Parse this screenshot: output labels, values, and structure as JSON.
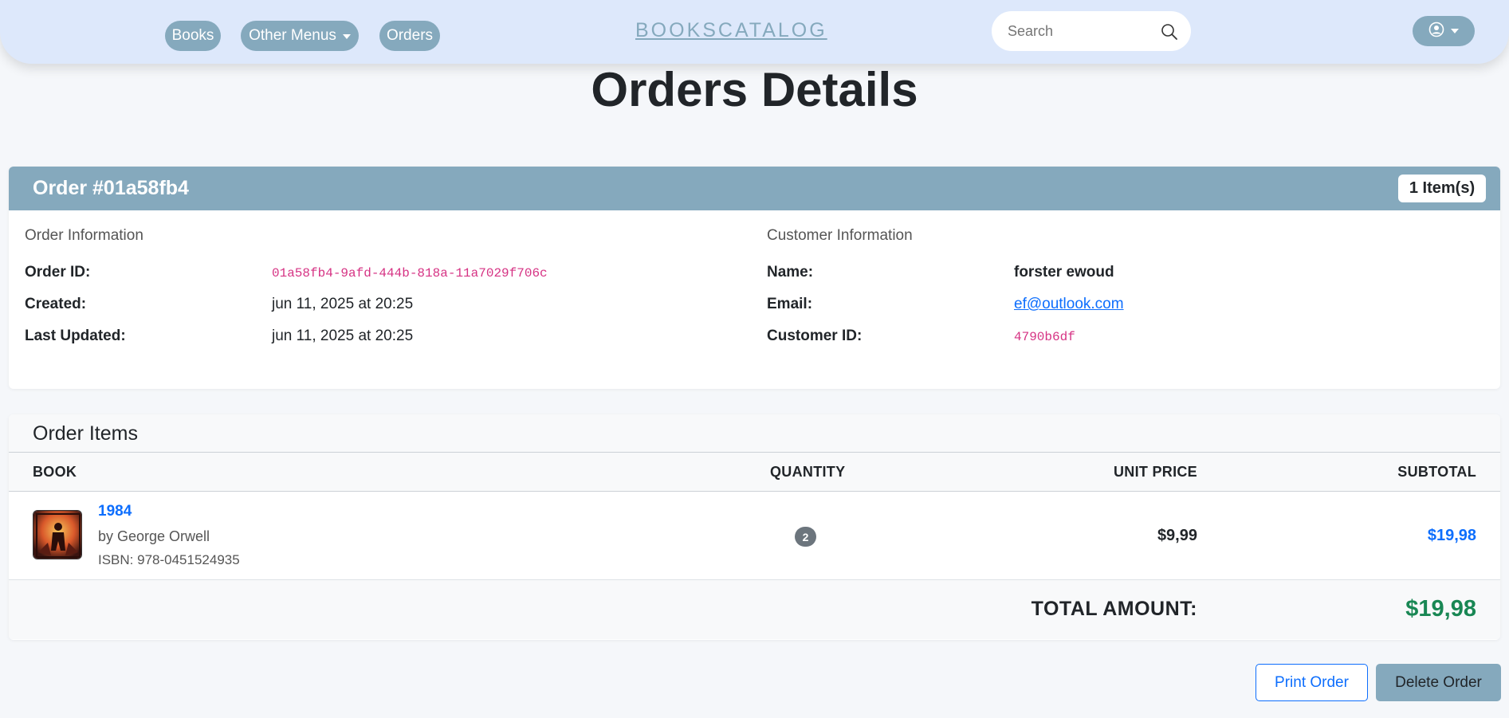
{
  "nav": {
    "books_label": "Books",
    "other_menus_label": "Other Menus",
    "orders_label": "Orders",
    "brand": "BOOKSCATALOG",
    "search_placeholder": "Search",
    "accent_color": "#85a9bd"
  },
  "page_title": "Orders Details",
  "order": {
    "header_title": "Order #01a58fb4",
    "items_badge": "1 Item(s)",
    "order_info": {
      "heading": "Order Information",
      "order_id_label": "Order ID:",
      "order_id": "01a58fb4-9afd-444b-818a-11a7029f706c",
      "created_label": "Created:",
      "created": "jun 11, 2025 at 20:25",
      "updated_label": "Last Updated:",
      "updated": "jun 11, 2025 at 20:25"
    },
    "customer_info": {
      "heading": "Customer Information",
      "name_label": "Name:",
      "name": "forster ewoud",
      "email_label": "Email:",
      "email": "ef@outlook.com",
      "customer_id_label": "Customer ID:",
      "customer_id": "4790b6df"
    }
  },
  "items": {
    "heading": "Order Items",
    "columns": {
      "book": "BOOK",
      "quantity": "QUANTITY",
      "unit_price": "UNIT PRICE",
      "subtotal": "SUBTOTAL"
    },
    "rows": [
      {
        "title": "1984",
        "author": "by George Orwell",
        "isbn": "ISBN: 978-0451524935",
        "quantity": "2",
        "unit_price": "$9,99",
        "subtotal": "$19,98"
      }
    ],
    "total_label": "TOTAL AMOUNT:",
    "total_value": "$19,98"
  },
  "actions": {
    "print_label": "Print Order",
    "delete_label": "Delete Order"
  }
}
